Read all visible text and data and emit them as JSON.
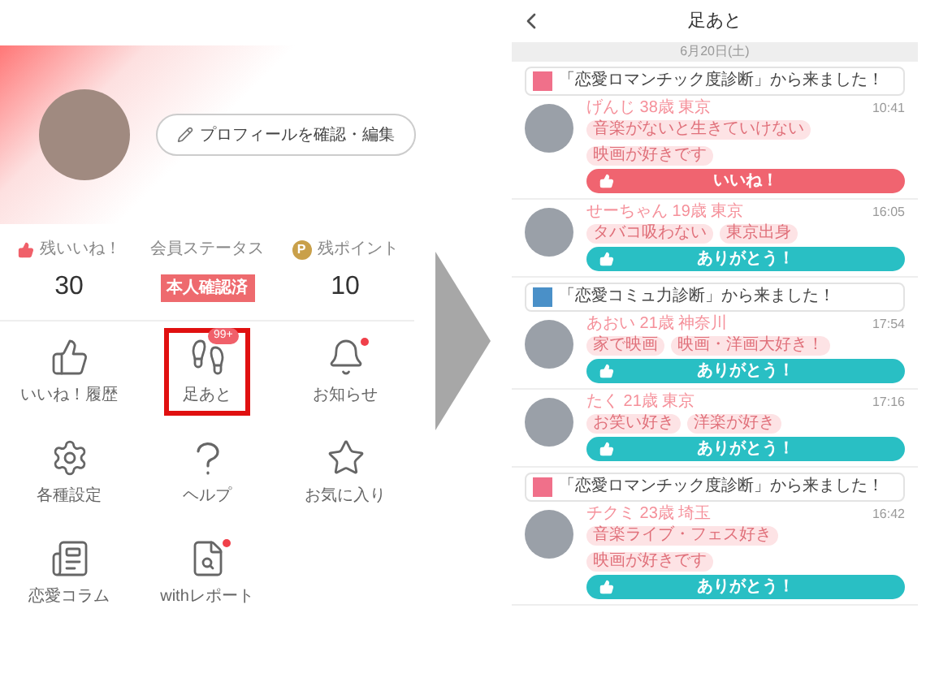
{
  "profile": {
    "edit_button": "プロフィールを確認・編集"
  },
  "stats": [
    {
      "kind": "likes",
      "label": "残いいね！",
      "value": "30"
    },
    {
      "kind": "status",
      "label": "会員ステータス",
      "value": "本人確認済"
    },
    {
      "kind": "points",
      "label": "残ポイント",
      "value": "10",
      "icon_text": "P"
    }
  ],
  "menu": [
    {
      "kind": "thumb",
      "label": "いいね！履歴",
      "selected": false,
      "dot": false
    },
    {
      "kind": "footprints",
      "label": "足あと",
      "badge": "99+",
      "selected": true,
      "dot": false
    },
    {
      "kind": "bell",
      "label": "お知らせ",
      "selected": false,
      "dot": true
    },
    {
      "kind": "gear",
      "label": "各種設定",
      "selected": false,
      "dot": false
    },
    {
      "kind": "question",
      "label": "ヘルプ",
      "selected": false,
      "dot": false
    },
    {
      "kind": "star",
      "label": "お気に入り",
      "selected": false,
      "dot": false
    },
    {
      "kind": "newspaper",
      "label": "恋愛コラム",
      "selected": false,
      "dot": false
    },
    {
      "kind": "report",
      "label": "withレポート",
      "selected": false,
      "dot": true
    }
  ],
  "footprints": {
    "title": "足あと",
    "date": "6月20日(土)",
    "visits": [
      {
        "origin": "「恋愛ロマンチック度診断」から来ました！",
        "name": "げんじ 38歳 東京",
        "time": "10:41",
        "tags": [
          "音楽がないと生きていけない",
          "映画が好きです"
        ],
        "action": {
          "kind": "like",
          "label": "いいね！"
        }
      },
      {
        "name": "せーちゃん 19歳 東京",
        "time": "16:05",
        "tags": [
          "タバコ吸わない",
          "東京出身"
        ],
        "action": {
          "kind": "thanks",
          "label": "ありがとう！"
        }
      },
      {
        "origin": "「恋愛コミュ力診断」から来ました！",
        "name": "あおい 21歳 神奈川",
        "time": "17:54",
        "tags": [
          "家で映画",
          "映画・洋画大好き！"
        ],
        "action": {
          "kind": "thanks",
          "label": "ありがとう！"
        }
      },
      {
        "name": "たく 21歳 東京",
        "time": "17:16",
        "tags": [
          "お笑い好き",
          "洋楽が好き"
        ],
        "action": {
          "kind": "thanks",
          "label": "ありがとう！"
        }
      },
      {
        "origin": "「恋愛ロマンチック度診断」から来ました！",
        "name": "チクミ 23歳 埼玉",
        "time": "16:42",
        "tags": [
          "音楽ライブ・フェス好き",
          "映画が好きです"
        ],
        "action": {
          "kind": "thanks",
          "label": "ありがとう！"
        }
      }
    ]
  }
}
